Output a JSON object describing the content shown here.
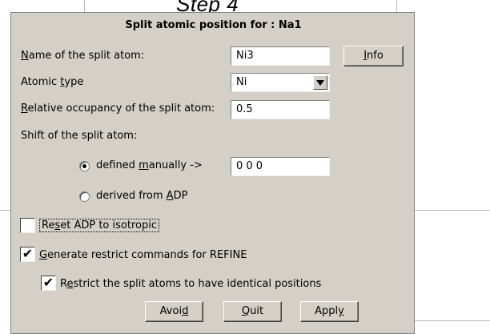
{
  "background": {
    "title": "Step 4"
  },
  "dialog": {
    "title": "Split atomic position for : Na1",
    "name_label": "Name of the split atom:",
    "name_value": "Ni3",
    "info_button": "Info",
    "type_label": "Atomic type",
    "type_value": "Ni",
    "occupancy_label": "Relative occupancy of the split atom:",
    "occupancy_value": "0.5",
    "shift_label": "Shift of the split atom:",
    "radio_manual": {
      "label": "defined manually ->",
      "selected": true
    },
    "manual_value": "0 0 0",
    "radio_adp": {
      "label": "derived from ADP",
      "selected": false
    },
    "reset_adp": {
      "label": "Reset ADP to isotropic",
      "checked": false
    },
    "generate_restrict": {
      "label": "Generate restrict commands for REFINE",
      "checked": true
    },
    "restrict_identical": {
      "label": "Restrict the split atoms to have identical positions",
      "checked": true
    },
    "buttons": {
      "avoid": "Avoid",
      "quit": "Quit",
      "apply": "Apply"
    }
  }
}
